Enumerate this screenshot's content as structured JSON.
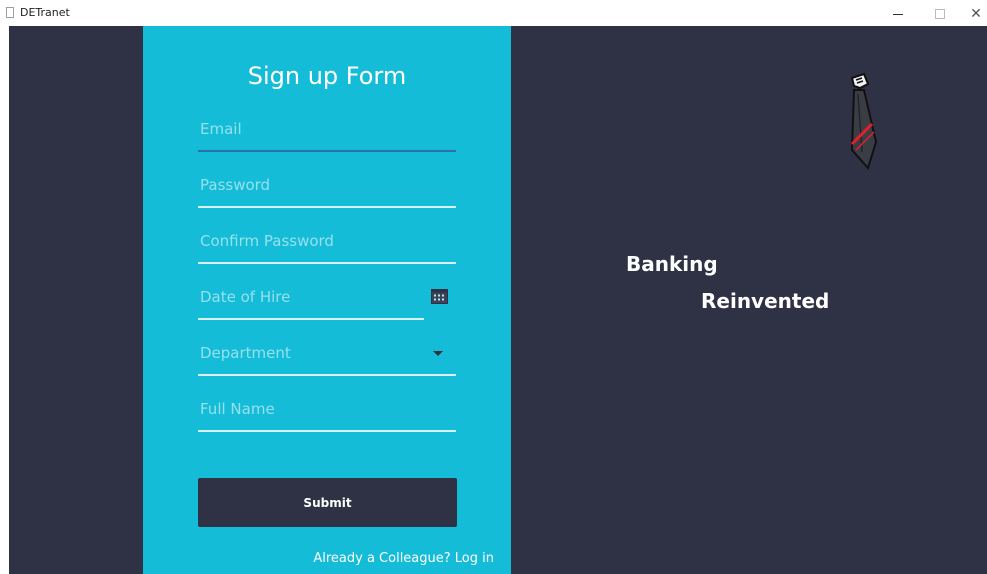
{
  "window": {
    "title": "DETranet",
    "controls": {
      "minimize": "–",
      "maximize": "□",
      "close": "✕"
    }
  },
  "form": {
    "title": "Sign up Form",
    "fields": {
      "email": {
        "placeholder": "Email"
      },
      "password": {
        "placeholder": "Password"
      },
      "confirm_password": {
        "placeholder": "Confirm Password"
      },
      "date_of_hire": {
        "placeholder": "Date of Hire"
      },
      "department": {
        "placeholder": "Department"
      },
      "full_name": {
        "placeholder": "Full Name"
      }
    },
    "submit_label": "Submit",
    "login_link": "Already a Colleague? Log in"
  },
  "tagline": {
    "line1": "Banking",
    "line2": "Reinvented"
  },
  "icons": {
    "calendar": "calendar-icon",
    "dropdown": "chevron-down-icon",
    "logo": "tie-logo"
  },
  "colors": {
    "background": "#2e3244",
    "form_panel": "#14bcd8",
    "active_underline": "#2a6fb0",
    "logo_stripe": "#e0202c"
  }
}
